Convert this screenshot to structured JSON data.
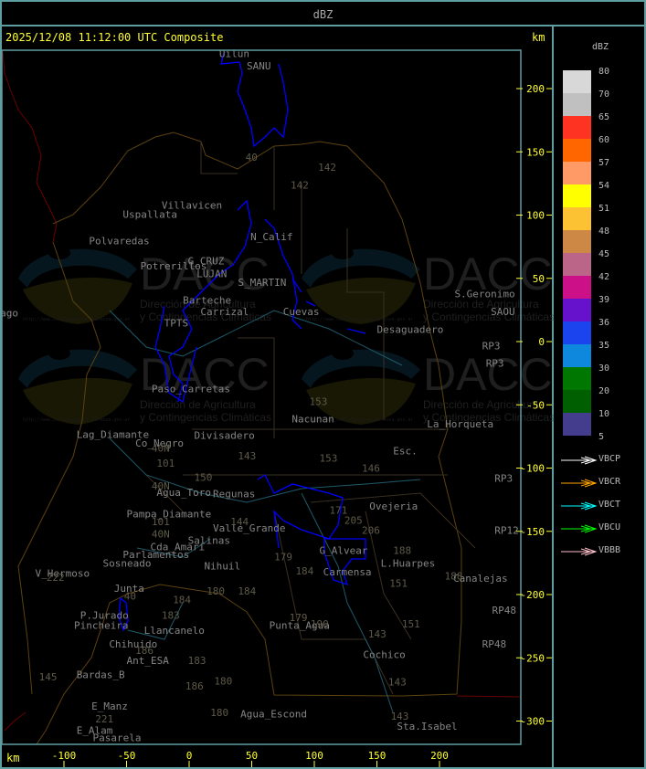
{
  "header": {
    "title": "dBZ"
  },
  "panel": {
    "timestamp_title": "2025/12/08 11:12:00 UTC Composite",
    "unit_top": "km",
    "unit_bottom": "km"
  },
  "axes": {
    "x_ticks": [
      -100,
      -50,
      0,
      50,
      100,
      150,
      200
    ],
    "y_ticks": [
      200,
      150,
      100,
      50,
      0,
      -50,
      -100,
      -150,
      -200,
      -250,
      -300
    ],
    "x_range_km": [
      -150,
      263
    ],
    "y_range_km": [
      -318,
      230
    ],
    "tick_color": "#ffff33",
    "frame_color": "#5f9ea0"
  },
  "legend": {
    "title": "dBZ",
    "scale": [
      {
        "label": "80",
        "color": "#d8d8d8"
      },
      {
        "label": "70",
        "color": "#c0c0c0"
      },
      {
        "label": "65",
        "color": "#ff3322"
      },
      {
        "label": "60",
        "color": "#ff6600"
      },
      {
        "label": "57",
        "color": "#ff9966"
      },
      {
        "label": "54",
        "color": "#ffff00"
      },
      {
        "label": "51",
        "color": "#fcc233"
      },
      {
        "label": "48",
        "color": "#cc8844"
      },
      {
        "label": "45",
        "color": "#bb6688"
      },
      {
        "label": "42",
        "color": "#cc1188"
      },
      {
        "label": "39",
        "color": "#6611cc"
      },
      {
        "label": "36",
        "color": "#1c44ee"
      },
      {
        "label": "35",
        "color": "#0d88dd"
      },
      {
        "label": "30",
        "color": "#007700"
      },
      {
        "label": "20",
        "color": "#005f00"
      },
      {
        "label": "10",
        "color": "#443c8c"
      },
      {
        "label": "5",
        "color": ""
      }
    ],
    "radars": [
      {
        "label": "VBCP",
        "color": "#ffffff"
      },
      {
        "label": "VBCR",
        "color": "#ffa500"
      },
      {
        "label": "VBCT",
        "color": "#00ffff"
      },
      {
        "label": "VBCU",
        "color": "#00ff00"
      },
      {
        "label": "VBBB",
        "color": "#ffc0cb"
      }
    ]
  },
  "watermark": {
    "logo_text": "DACC",
    "line1": "Dirección de Agricultura",
    "line2": "y Contingencias Climáticas",
    "url": "http://www.contingencias.mendoza.gov.ar"
  },
  "map": {
    "echo_color": "#0000ff",
    "places": [
      {
        "name": "Uilun",
        "x": 24,
        "y": 225
      },
      {
        "name": "SANU",
        "x": 46,
        "y": 215
      },
      {
        "name": "Villavicen",
        "x": -22,
        "y": 105
      },
      {
        "name": "Uspallata",
        "x": -53,
        "y": 98
      },
      {
        "name": "Polvaredas",
        "x": -80,
        "y": 77
      },
      {
        "name": "Potrerillos",
        "x": -39,
        "y": 57
      },
      {
        "name": "G_CRUZ",
        "x": -1,
        "y": 61
      },
      {
        "name": "LUJAN",
        "x": 6,
        "y": 51
      },
      {
        "name": "S_MARTIN",
        "x": 39,
        "y": 44
      },
      {
        "name": "N_Calif",
        "x": 49,
        "y": 80
      },
      {
        "name": "Barteche",
        "x": -5,
        "y": 30
      },
      {
        "name": "Carrizal",
        "x": 9,
        "y": 21
      },
      {
        "name": "TPTS",
        "x": -20,
        "y": 12
      },
      {
        "name": "Cuevas",
        "x": 75,
        "y": 21
      },
      {
        "name": "Desaguadero",
        "x": 150,
        "y": 7
      },
      {
        "name": "S.Geronimo",
        "x": 212,
        "y": 35
      },
      {
        "name": "SAOU",
        "x": 241,
        "y": 21
      },
      {
        "name": "RP3",
        "x": 234,
        "y": -6
      },
      {
        "name": "RP3",
        "x": 237,
        "y": -20
      },
      {
        "name": "RP3",
        "x": 244,
        "y": -111
      },
      {
        "name": "RP12",
        "x": 244,
        "y": -152
      },
      {
        "name": "RP48",
        "x": 242,
        "y": -215
      },
      {
        "name": "RP48",
        "x": 234,
        "y": -242
      },
      {
        "name": "La_Horqueta",
        "x": 190,
        "y": -68
      },
      {
        "name": "Nacunan",
        "x": 82,
        "y": -64
      },
      {
        "name": "Paso_Carretas",
        "x": -30,
        "y": -40
      },
      {
        "name": "Lag_Diamante",
        "x": -90,
        "y": -76
      },
      {
        "name": "Co_Negro",
        "x": -43,
        "y": -83
      },
      {
        "name": "Divisadero",
        "x": 4,
        "y": -77
      },
      {
        "name": "Esc.",
        "x": 163,
        "y": -89
      },
      {
        "name": "Agua_Toro",
        "x": -26,
        "y": -122
      },
      {
        "name": "Regunas",
        "x": 19,
        "y": -123
      },
      {
        "name": "Pampa_Diamante",
        "x": -50,
        "y": -139
      },
      {
        "name": "Valle_Grande",
        "x": 19,
        "y": -150
      },
      {
        "name": "Salinas",
        "x": -1,
        "y": -160
      },
      {
        "name": "Cda_Amari",
        "x": -31,
        "y": -165
      },
      {
        "name": "Parlamentos",
        "x": -53,
        "y": -171
      },
      {
        "name": "Sosneado",
        "x": -69,
        "y": -178
      },
      {
        "name": "Nihuil",
        "x": 12,
        "y": -180
      },
      {
        "name": "V_Hermoso",
        "x": -123,
        "y": -186
      },
      {
        "name": "Junta",
        "x": -60,
        "y": -198
      },
      {
        "name": "P.Jurado",
        "x": -87,
        "y": -219
      },
      {
        "name": "Pincheira",
        "x": -92,
        "y": -227
      },
      {
        "name": "Llancanelo",
        "x": -36,
        "y": -231
      },
      {
        "name": "Chihuido",
        "x": -64,
        "y": -242
      },
      {
        "name": "Ant_ESA",
        "x": -50,
        "y": -255
      },
      {
        "name": "Bardas_B",
        "x": -90,
        "y": -266
      },
      {
        "name": "E_Manz",
        "x": -78,
        "y": -291
      },
      {
        "name": "E_Alam",
        "x": -90,
        "y": -310
      },
      {
        "name": "Pasarela",
        "x": -77,
        "y": -316
      },
      {
        "name": "Punta_Agua",
        "x": 64,
        "y": -227
      },
      {
        "name": "Agua_Escond",
        "x": 41,
        "y": -297
      },
      {
        "name": "Ovejeria",
        "x": 144,
        "y": -133
      },
      {
        "name": "L.Huarpes",
        "x": 153,
        "y": -178
      },
      {
        "name": "Canalejas",
        "x": 211,
        "y": -190
      },
      {
        "name": "Carmensa",
        "x": 107,
        "y": -185
      },
      {
        "name": "G_Alvear",
        "x": 104,
        "y": -168
      },
      {
        "name": "Cochico",
        "x": 139,
        "y": -250
      },
      {
        "name": "Sta.Isabel",
        "x": 166,
        "y": -307
      },
      {
        "name": "ago",
        "x": -151,
        "y": 20
      }
    ],
    "routes": [
      {
        "name": "40",
        "x": 45,
        "y": 143
      },
      {
        "name": "142",
        "x": 103,
        "y": 135
      },
      {
        "name": "142",
        "x": 81,
        "y": 121
      },
      {
        "name": "153",
        "x": 96,
        "y": -50
      },
      {
        "name": "153",
        "x": 104,
        "y": -95
      },
      {
        "name": "146",
        "x": 138,
        "y": -103
      },
      {
        "name": "143",
        "x": 39,
        "y": -93
      },
      {
        "name": "150",
        "x": 4,
        "y": -110
      },
      {
        "name": "101",
        "x": -26,
        "y": -99
      },
      {
        "name": "40N",
        "x": -30,
        "y": -87
      },
      {
        "name": "40N",
        "x": -30,
        "y": -117
      },
      {
        "name": "40N",
        "x": -30,
        "y": -155
      },
      {
        "name": "101",
        "x": -30,
        "y": -145
      },
      {
        "name": "144",
        "x": 33,
        "y": -145
      },
      {
        "name": "171",
        "x": 112,
        "y": -136
      },
      {
        "name": "179",
        "x": 68,
        "y": -173
      },
      {
        "name": "184",
        "x": 85,
        "y": -184
      },
      {
        "name": "184",
        "x": 39,
        "y": -200
      },
      {
        "name": "180",
        "x": 14,
        "y": -200
      },
      {
        "name": "184",
        "x": -13,
        "y": -207
      },
      {
        "name": "179",
        "x": 80,
        "y": -221
      },
      {
        "name": "190",
        "x": 97,
        "y": -226
      },
      {
        "name": "183",
        "x": -22,
        "y": -219
      },
      {
        "name": "186",
        "x": -43,
        "y": -247
      },
      {
        "name": "183",
        "x": -1,
        "y": -255
      },
      {
        "name": "180",
        "x": 20,
        "y": -271
      },
      {
        "name": "186",
        "x": -3,
        "y": -275
      },
      {
        "name": "180",
        "x": 17,
        "y": -296
      },
      {
        "name": "205",
        "x": 124,
        "y": -144
      },
      {
        "name": "206",
        "x": 138,
        "y": -152
      },
      {
        "name": "188",
        "x": 163,
        "y": -168
      },
      {
        "name": "151",
        "x": 160,
        "y": -194
      },
      {
        "name": "151",
        "x": 170,
        "y": -226
      },
      {
        "name": "188",
        "x": 204,
        "y": -188
      },
      {
        "name": "143",
        "x": 143,
        "y": -234
      },
      {
        "name": "143",
        "x": 159,
        "y": -272
      },
      {
        "name": "143",
        "x": 161,
        "y": -299
      },
      {
        "name": "145",
        "x": -120,
        "y": -268
      },
      {
        "name": "222",
        "x": -114,
        "y": -189
      },
      {
        "name": "221",
        "x": -75,
        "y": -301
      },
      {
        "name": "40",
        "x": -52,
        "y": -204
      }
    ]
  }
}
